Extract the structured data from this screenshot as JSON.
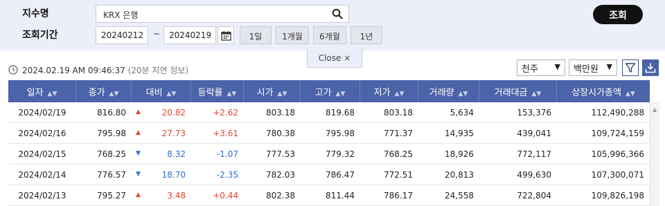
{
  "search": {
    "index_label": "지수명",
    "index_value": "KRX 은행",
    "period_label": "조회기간",
    "start_date": "20240212",
    "tilde": "~",
    "end_date": "20240219",
    "periods": [
      "1일",
      "1개월",
      "6개월",
      "1년"
    ],
    "submit_label": "조회",
    "close_label": "Close ×"
  },
  "info": {
    "timestamp": "2024.02.19 AM 09:46:37",
    "delay_note": "(20분 지연 정보)",
    "unit_volume": "천주",
    "unit_amount": "백만원",
    "dropdown_arrow": "▼"
  },
  "table": {
    "headers": [
      "일자",
      "종가",
      "대비",
      "등락률",
      "시가",
      "고가",
      "저가",
      "거래량",
      "거래대금",
      "상장시가총액"
    ],
    "sort_glyph": "▲▼",
    "rows": [
      {
        "date": "2024/02/19",
        "close": "816.80",
        "dir": "up",
        "change": "20.82",
        "rate": "+2.62",
        "open": "803.18",
        "high": "819.68",
        "low": "803.18",
        "volume": "5,634",
        "amount": "153,376",
        "cap": "112,490,288"
      },
      {
        "date": "2024/02/16",
        "close": "795.98",
        "dir": "up",
        "change": "27.73",
        "rate": "+3.61",
        "open": "780.38",
        "high": "795.98",
        "low": "771.37",
        "volume": "14,935",
        "amount": "439,041",
        "cap": "109,724,159"
      },
      {
        "date": "2024/02/15",
        "close": "768.25",
        "dir": "down",
        "change": "8.32",
        "rate": "-1.07",
        "open": "777.53",
        "high": "779.32",
        "low": "768.25",
        "volume": "18,926",
        "amount": "772,117",
        "cap": "105,996,366"
      },
      {
        "date": "2024/02/14",
        "close": "776.57",
        "dir": "down",
        "change": "18.70",
        "rate": "-2.35",
        "open": "782.03",
        "high": "786.47",
        "low": "772.51",
        "volume": "20,813",
        "amount": "499,630",
        "cap": "107,300,071"
      },
      {
        "date": "2024/02/13",
        "close": "795.27",
        "dir": "up",
        "change": "3.48",
        "rate": "+0.44",
        "open": "802.38",
        "high": "811.44",
        "low": "786.17",
        "volume": "24,558",
        "amount": "722,804",
        "cap": "109,826,198"
      }
    ]
  },
  "colors": {
    "header_bg": "#4b63a8",
    "up": "#e2452b",
    "down": "#2d6fd1",
    "panel_bg": "#eceef9"
  }
}
